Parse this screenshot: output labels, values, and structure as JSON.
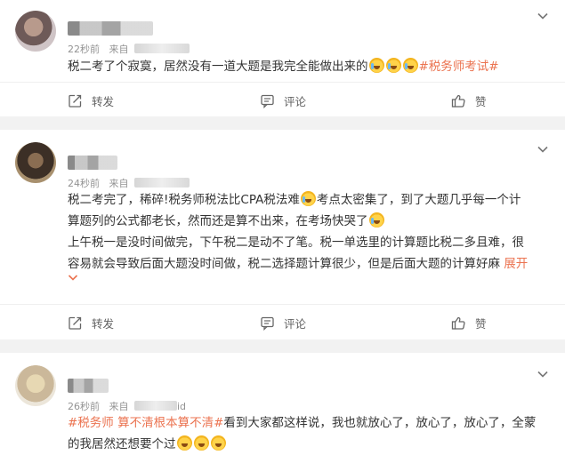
{
  "posts": [
    {
      "time": "22秒前",
      "source_prefix": "来自",
      "text_lines": [
        {
          "before": "税二考了个寂寞，居然没有一道大题是我完全能做出来的",
          "tag": "#税务师考试#"
        }
      ],
      "actions": {
        "repost": "转发",
        "comment": "评论",
        "like": "赞"
      }
    },
    {
      "time": "24秒前",
      "source_prefix": "来自",
      "lines": [
        "税二考完了，稀碎!税务师税法比CPA税法难",
        "考点太密集了，到了大题几乎每一个计",
        "算题列的公式都老长，然而还是算不出来，在考场快哭了",
        "上午税一是没时间做完，下午税二是动不了笔。税一单选里的计算题比税二多且难，很",
        "容易就会导致后面大题没时间做，税二选择题计算很少，但是后面大题的计算好麻"
      ],
      "expand_label": "展开",
      "actions": {
        "repost": "转发",
        "comment": "评论",
        "like": "赞"
      }
    },
    {
      "time": "26秒前",
      "source_prefix": "来自",
      "source_suffix": "id",
      "tags": "#税务师 算不清根本算不清#",
      "line1_rest": "看到大家都这样说，我也就放心了，放心了，放心了，全蒙",
      "line2": "的我居然还想要个过"
    }
  ],
  "colors": {
    "accent": "#eb7350",
    "meta": "#939393",
    "text": "#333333",
    "page_bg": "#f2f2f2"
  },
  "icons": [
    "menu-chevron-icon",
    "repost-icon",
    "comment-icon",
    "like-icon",
    "emoji-icon"
  ]
}
